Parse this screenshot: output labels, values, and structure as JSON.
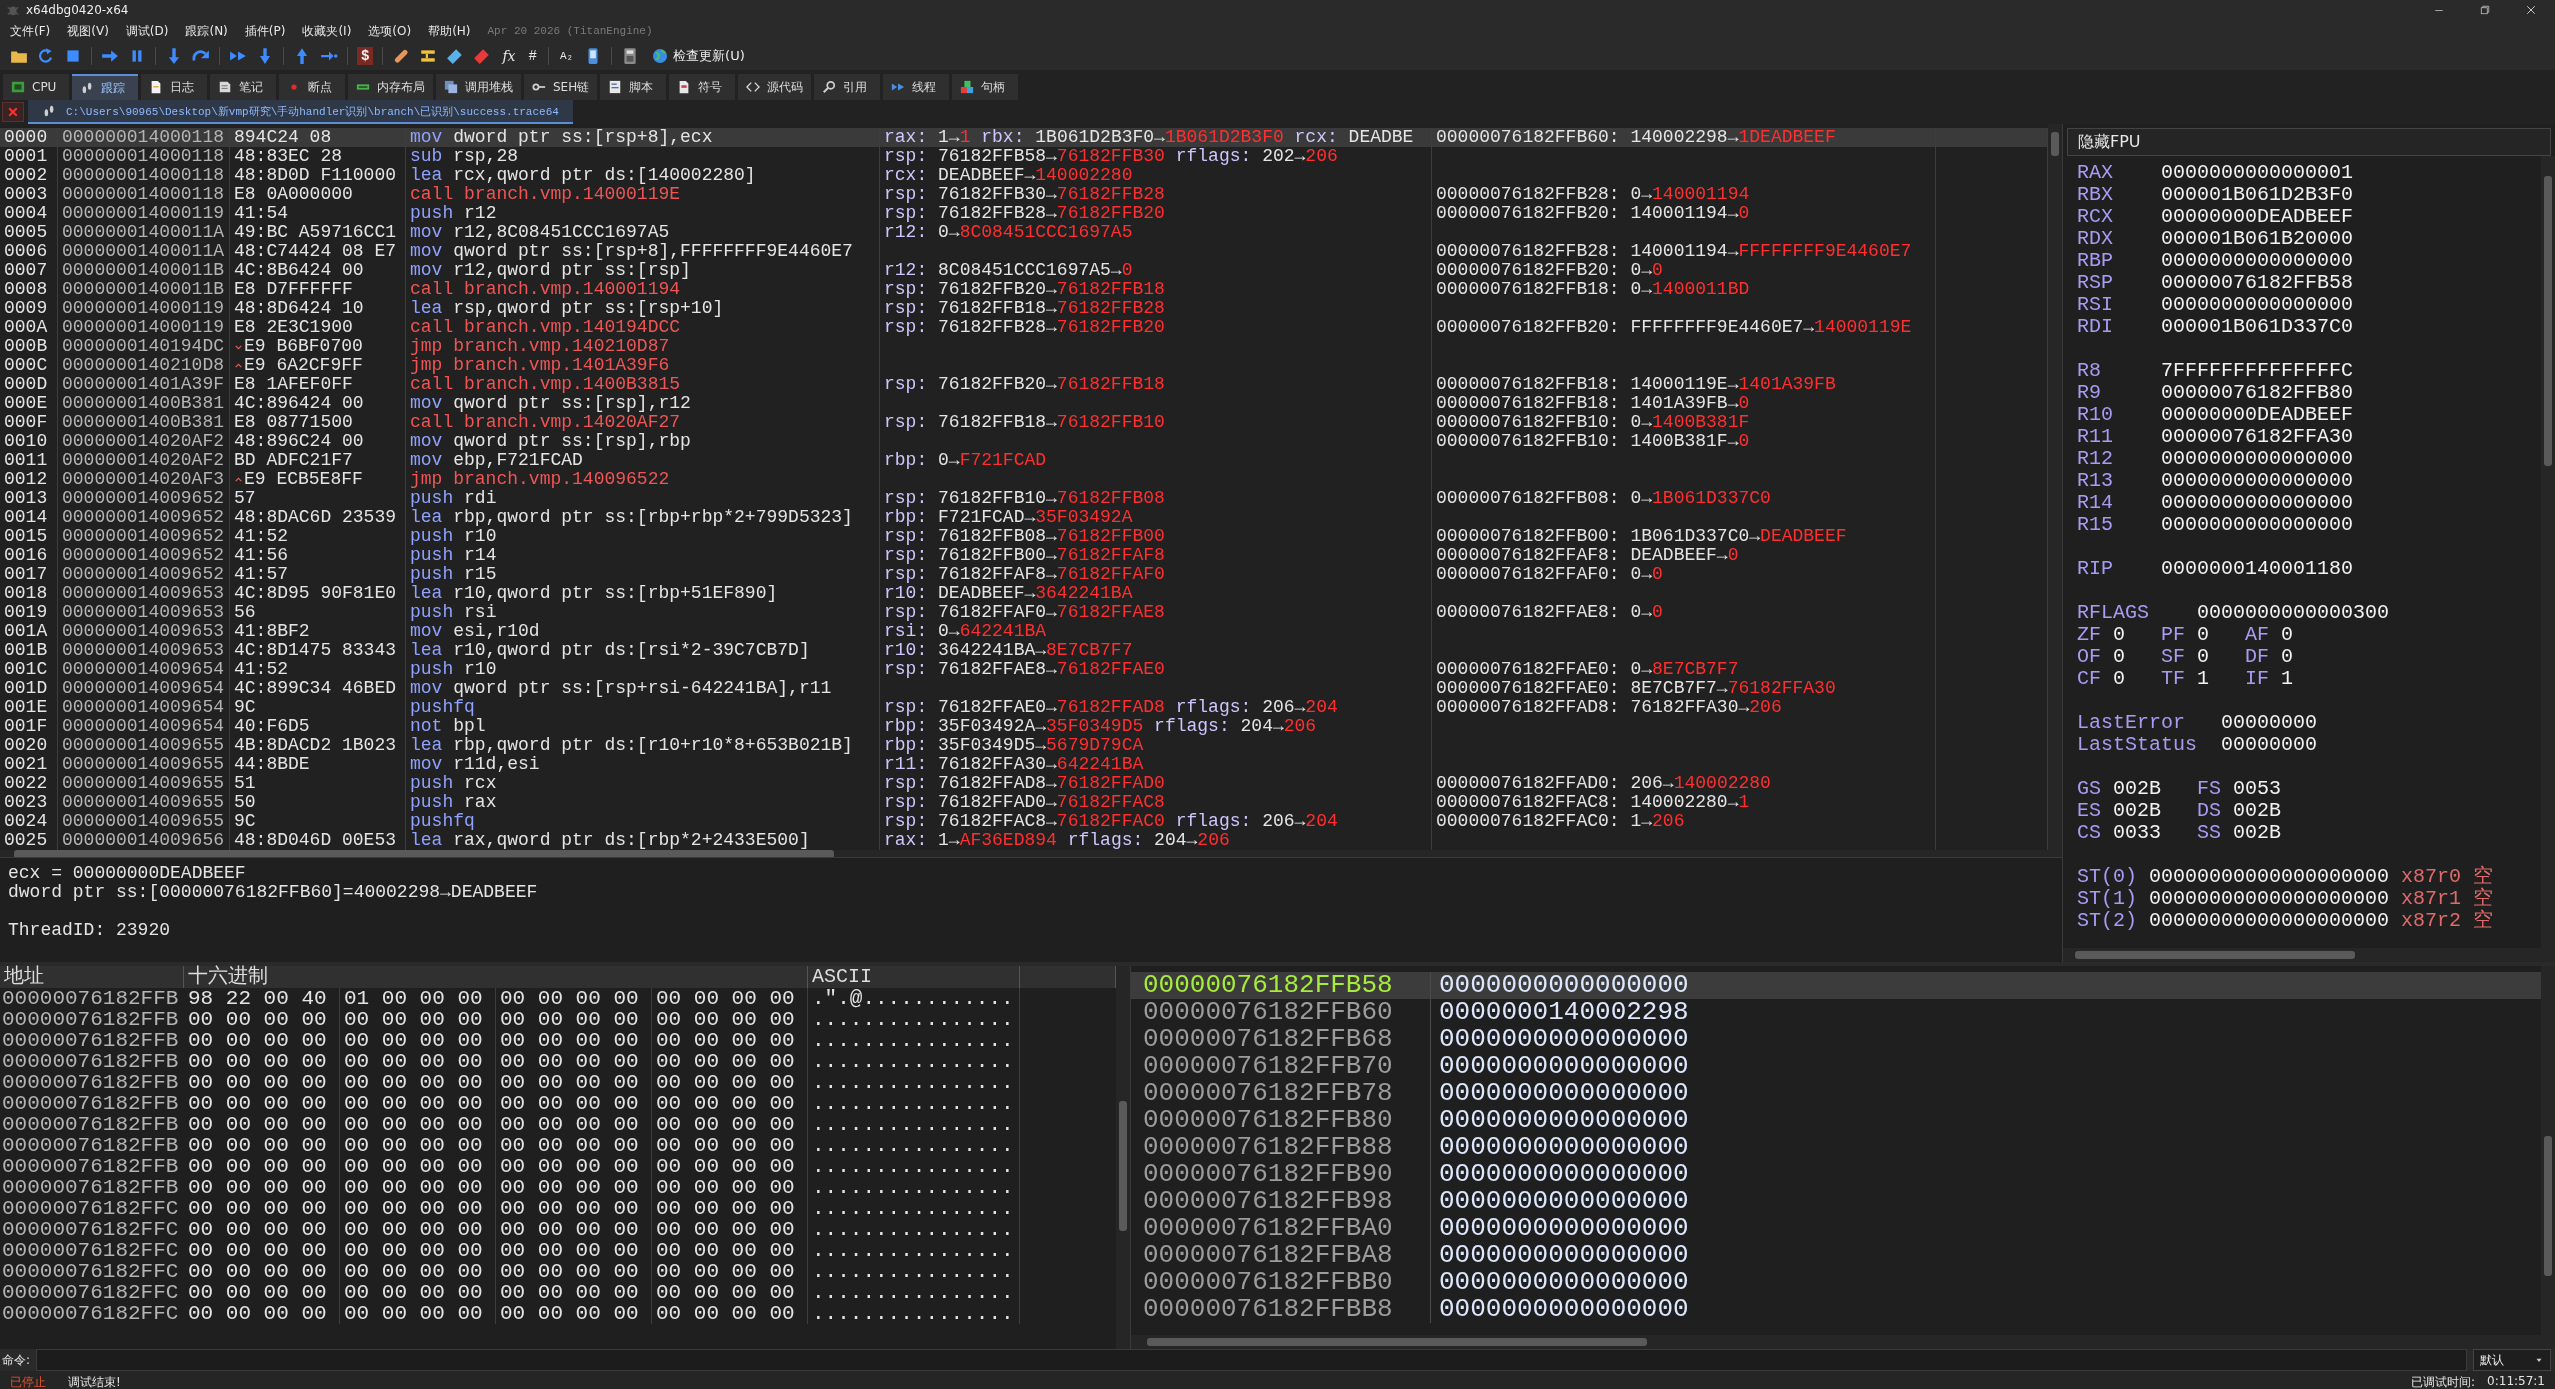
{
  "window": {
    "title": "x64dbg0420-x64"
  },
  "menu": [
    "文件(F)",
    "视图(V)",
    "调试(D)",
    "跟踪(N)",
    "插件(P)",
    "收藏夹(I)",
    "选项(O)",
    "帮助(H)"
  ],
  "build": "Apr 20 2026 (TitanEngine)",
  "toolbar": {
    "glyphs": [
      "$",
      "fx",
      "#",
      "A₂"
    ],
    "update": "检查更新(U)"
  },
  "tabs": [
    {
      "label": "CPU",
      "selected": false
    },
    {
      "label": "跟踪",
      "selected": true
    },
    {
      "label": "日志",
      "selected": false
    },
    {
      "label": "笔记",
      "selected": false
    },
    {
      "label": "断点",
      "selected": false
    },
    {
      "label": "内存布局",
      "selected": false
    },
    {
      "label": "调用堆栈",
      "selected": false
    },
    {
      "label": "SEH链",
      "selected": false
    },
    {
      "label": "脚本",
      "selected": false
    },
    {
      "label": "符号",
      "selected": false
    },
    {
      "label": "源代码",
      "selected": false
    },
    {
      "label": "引用",
      "selected": false
    },
    {
      "label": "线程",
      "selected": false
    },
    {
      "label": "句柄",
      "selected": false
    }
  ],
  "file_tab": {
    "path": "C:\\Users\\90965\\Desktop\\新vmp研究\\手动handler识别\\branch\\已识别\\success.trace64"
  },
  "trace": {
    "rows": [
      {
        "index": "0000",
        "address": "000000014000118",
        "bytes": "894C24 08",
        "mnemonic": "mov",
        "operands": "dword ptr ss:[rsp+8],ecx",
        "kind": "normal",
        "selected": true,
        "regs": [
          {
            "reg": "rax:",
            "old": "1→",
            "new": "1"
          },
          {
            "reg": "rbx:",
            "old": "1B061D2B3F0→",
            "new": "1B061D2B3F0"
          },
          {
            "reg": "rcx:",
            "old": "DEADBE"
          }
        ],
        "mem": {
          "address": "00000076182FFB60:",
          "old": "140002298→",
          "new": "1DEADBEEF"
        }
      },
      {
        "index": "0001",
        "address": "000000014000118",
        "bytes": "48:83EC 28",
        "mnemonic": "sub",
        "operands": "rsp,28",
        "kind": "normal",
        "selected": false,
        "regs": [
          {
            "reg": "rsp:",
            "old": "76182FFB58→",
            "new": "76182FFB30"
          },
          {
            "reg": "rflags:",
            "old": "202→",
            "new": "206"
          }
        ]
      },
      {
        "index": "0002",
        "address": "000000014000118",
        "bytes": "48:8D0D F110000",
        "mnemonic": "lea",
        "operands": "rcx,qword ptr ds:[140002280]",
        "kind": "normal",
        "selected": false,
        "regs": [
          {
            "reg": "rcx:",
            "old": "DEADBEEF→",
            "new": "140002280"
          }
        ]
      },
      {
        "index": "0003",
        "address": "000000014000118",
        "bytes": "E8 0A000000",
        "mnemonic": "call",
        "operands": "branch.vmp.14000119E",
        "kind": "branch",
        "selected": false,
        "regs": [
          {
            "reg": "rsp:",
            "old": "76182FFB30→",
            "new": "76182FFB28"
          }
        ],
        "mem": {
          "address": "00000076182FFB28:",
          "old": "0→",
          "new": "140001194"
        }
      },
      {
        "index": "0004",
        "address": "000000014000119",
        "bytes": "41:54",
        "mnemonic": "push",
        "operands": "r12",
        "kind": "normal",
        "selected": false,
        "regs": [
          {
            "reg": "rsp:",
            "old": "76182FFB28→",
            "new": "76182FFB20"
          }
        ],
        "mem": {
          "address": "00000076182FFB20:",
          "old": "140001194→",
          "new": "0"
        }
      },
      {
        "index": "0005",
        "address": "00000001400011A",
        "bytes": "49:BC A59716CC1",
        "mnemonic": "mov",
        "operands": "r12,8C08451CCC1697A5",
        "kind": "normal",
        "selected": false,
        "regs": [
          {
            "reg": "r12:",
            "old": "0→",
            "new": "8C08451CCC1697A5"
          }
        ]
      },
      {
        "index": "0006",
        "address": "00000001400011A",
        "bytes": "48:C74424 08 E7",
        "mnemonic": "mov",
        "operands": "qword ptr ss:[rsp+8],FFFFFFFF9E4460E7",
        "kind": "normal",
        "selected": false,
        "mem": {
          "address": "00000076182FFB28:",
          "old": "140001194→",
          "new": "FFFFFFFF9E4460E7"
        }
      },
      {
        "index": "0007",
        "address": "00000001400011B",
        "bytes": "4C:8B6424 00",
        "mnemonic": "mov",
        "operands": "r12,qword ptr ss:[rsp]",
        "kind": "normal",
        "selected": false,
        "regs": [
          {
            "reg": "r12:",
            "old": "8C08451CCC1697A5→",
            "new": "0"
          }
        ],
        "mem": {
          "address": "00000076182FFB20:",
          "old": "0→",
          "new": "0"
        }
      },
      {
        "index": "0008",
        "address": "00000001400011B",
        "bytes": "E8 D7FFFFFF",
        "mnemonic": "call",
        "operands": "branch.vmp.140001194",
        "kind": "branch",
        "selected": false,
        "regs": [
          {
            "reg": "rsp:",
            "old": "76182FFB20→",
            "new": "76182FFB18"
          }
        ],
        "mem": {
          "address": "00000076182FFB18:",
          "old": "0→",
          "new": "1400011BD"
        }
      },
      {
        "index": "0009",
        "address": "000000014000119",
        "bytes": "48:8D6424 10",
        "mnemonic": "lea",
        "operands": "rsp,qword ptr ss:[rsp+10]",
        "kind": "normal",
        "selected": false,
        "regs": [
          {
            "reg": "rsp:",
            "old": "76182FFB18→",
            "new": "76182FFB28"
          }
        ]
      },
      {
        "index": "000A",
        "address": "000000014000119",
        "bytes": "E8 2E3C1900",
        "mnemonic": "call",
        "operands": "branch.vmp.140194DCC",
        "kind": "branch",
        "selected": false,
        "regs": [
          {
            "reg": "rsp:",
            "old": "76182FFB28→",
            "new": "76182FFB20"
          }
        ],
        "mem": {
          "address": "00000076182FFB20:",
          "old": "FFFFFFFF9E4460E7→",
          "new": "14000119E"
        }
      },
      {
        "index": "000B",
        "address": "0000000140194DC",
        "bytes": "E9 B6BF0700",
        "jump_up": false,
        "mnemonic": "jmp",
        "operands": "branch.vmp.140210D87",
        "kind": "branch",
        "selected": false
      },
      {
        "index": "000C",
        "address": "0000000140210D8",
        "bytes": "E9 6A2CF9FF",
        "jump_up": true,
        "mnemonic": "jmp",
        "operands": "branch.vmp.1401A39F6",
        "kind": "branch",
        "selected": false
      },
      {
        "index": "000D",
        "address": "00000001401A39F",
        "bytes": "E8 1AFEF0FF",
        "mnemonic": "call",
        "operands": "branch.vmp.1400B3815",
        "kind": "branch",
        "selected": false,
        "regs": [
          {
            "reg": "rsp:",
            "old": "76182FFB20→",
            "new": "76182FFB18"
          }
        ],
        "mem": {
          "address": "00000076182FFB18:",
          "old": "14000119E→",
          "new": "1401A39FB"
        }
      },
      {
        "index": "000E",
        "address": "00000001400B381",
        "bytes": "4C:896424 00",
        "mnemonic": "mov",
        "operands": "qword ptr ss:[rsp],r12",
        "kind": "normal",
        "selected": false,
        "mem": {
          "address": "00000076182FFB18:",
          "old": "1401A39FB→",
          "new": "0"
        }
      },
      {
        "index": "000F",
        "address": "00000001400B381",
        "bytes": "E8 08771500",
        "mnemonic": "call",
        "operands": "branch.vmp.14020AF27",
        "kind": "branch",
        "selected": false,
        "regs": [
          {
            "reg": "rsp:",
            "old": "76182FFB18→",
            "new": "76182FFB10"
          }
        ],
        "mem": {
          "address": "00000076182FFB10:",
          "old": "0→",
          "new": "1400B381F"
        }
      },
      {
        "index": "0010",
        "address": "000000014020AF2",
        "bytes": "48:896C24 00",
        "mnemonic": "mov",
        "operands": "qword ptr ss:[rsp],rbp",
        "kind": "normal",
        "selected": false,
        "mem": {
          "address": "00000076182FFB10:",
          "old": "1400B381F→",
          "new": "0"
        }
      },
      {
        "index": "0011",
        "address": "000000014020AF2",
        "bytes": "BD ADFC21F7",
        "mnemonic": "mov",
        "operands": "ebp,F721FCAD",
        "kind": "normal",
        "selected": false,
        "regs": [
          {
            "reg": "rbp:",
            "old": "0→",
            "new": "F721FCAD"
          }
        ]
      },
      {
        "index": "0012",
        "address": "000000014020AF3",
        "bytes": "E9 ECB5E8FF",
        "jump_up": true,
        "mnemonic": "jmp",
        "operands": "branch.vmp.140096522",
        "kind": "branch",
        "selected": false
      },
      {
        "index": "0013",
        "address": "000000014009652",
        "bytes": "57",
        "mnemonic": "push",
        "operands": "rdi",
        "kind": "normal",
        "selected": false,
        "regs": [
          {
            "reg": "rsp:",
            "old": "76182FFB10→",
            "new": "76182FFB08"
          }
        ],
        "mem": {
          "address": "00000076182FFB08:",
          "old": "0→",
          "new": "1B061D337C0"
        }
      },
      {
        "index": "0014",
        "address": "000000014009652",
        "bytes": "48:8DAC6D 23539",
        "mnemonic": "lea",
        "operands": "rbp,qword ptr ss:[rbp+rbp*2+799D5323]",
        "kind": "normal",
        "selected": false,
        "regs": [
          {
            "reg": "rbp:",
            "old": "F721FCAD→",
            "new": "35F03492A"
          }
        ]
      },
      {
        "index": "0015",
        "address": "000000014009652",
        "bytes": "41:52",
        "mnemonic": "push",
        "operands": "r10",
        "kind": "normal",
        "selected": false,
        "regs": [
          {
            "reg": "rsp:",
            "old": "76182FFB08→",
            "new": "76182FFB00"
          }
        ],
        "mem": {
          "address": "00000076182FFB00:",
          "old": "1B061D337C0→",
          "new": "DEADBEEF"
        }
      },
      {
        "index": "0016",
        "address": "000000014009652",
        "bytes": "41:56",
        "mnemonic": "push",
        "operands": "r14",
        "kind": "normal",
        "selected": false,
        "regs": [
          {
            "reg": "rsp:",
            "old": "76182FFB00→",
            "new": "76182FFAF8"
          }
        ],
        "mem": {
          "address": "00000076182FFAF8:",
          "old": "DEADBEEF→",
          "new": "0"
        }
      },
      {
        "index": "0017",
        "address": "000000014009652",
        "bytes": "41:57",
        "mnemonic": "push",
        "operands": "r15",
        "kind": "normal",
        "selected": false,
        "regs": [
          {
            "reg": "rsp:",
            "old": "76182FFAF8→",
            "new": "76182FFAF0"
          }
        ],
        "mem": {
          "address": "00000076182FFAF0:",
          "old": "0→",
          "new": "0"
        }
      },
      {
        "index": "0018",
        "address": "000000014009653",
        "bytes": "4C:8D95 90F81E0",
        "mnemonic": "lea",
        "operands": "r10,qword ptr ss:[rbp+51EF890]",
        "kind": "normal",
        "selected": false,
        "regs": [
          {
            "reg": "r10:",
            "old": "DEADBEEF→",
            "new": "3642241BA"
          }
        ]
      },
      {
        "index": "0019",
        "address": "000000014009653",
        "bytes": "56",
        "mnemonic": "push",
        "operands": "rsi",
        "kind": "normal",
        "selected": false,
        "regs": [
          {
            "reg": "rsp:",
            "old": "76182FFAF0→",
            "new": "76182FFAE8"
          }
        ],
        "mem": {
          "address": "00000076182FFAE8:",
          "old": "0→",
          "new": "0"
        }
      },
      {
        "index": "001A",
        "address": "000000014009653",
        "bytes": "41:8BF2",
        "mnemonic": "mov",
        "operands": "esi,r10d",
        "kind": "normal",
        "selected": false,
        "regs": [
          {
            "reg": "rsi:",
            "old": "0→",
            "new": "642241BA"
          }
        ]
      },
      {
        "index": "001B",
        "address": "000000014009653",
        "bytes": "4C:8D1475 83343",
        "mnemonic": "lea",
        "operands": "r10,qword ptr ds:[rsi*2-39C7CB7D]",
        "kind": "normal",
        "selected": false,
        "regs": [
          {
            "reg": "r10:",
            "old": "3642241BA→",
            "new": "8E7CB7F7"
          }
        ]
      },
      {
        "index": "001C",
        "address": "000000014009654",
        "bytes": "41:52",
        "mnemonic": "push",
        "operands": "r10",
        "kind": "normal",
        "selected": false,
        "regs": [
          {
            "reg": "rsp:",
            "old": "76182FFAE8→",
            "new": "76182FFAE0"
          }
        ],
        "mem": {
          "address": "00000076182FFAE0:",
          "old": "0→",
          "new": "8E7CB7F7"
        }
      },
      {
        "index": "001D",
        "address": "000000014009654",
        "bytes": "4C:899C34 46BED",
        "mnemonic": "mov",
        "operands": "qword ptr ss:[rsp+rsi-642241BA],r11",
        "kind": "normal",
        "selected": false,
        "mem": {
          "address": "00000076182FFAE0:",
          "old": "8E7CB7F7→",
          "new": "76182FFA30"
        }
      },
      {
        "index": "001E",
        "address": "000000014009654",
        "bytes": "9C",
        "mnemonic": "pushfq",
        "kind": "normal",
        "selected": false,
        "regs": [
          {
            "reg": "rsp:",
            "old": "76182FFAE0→",
            "new": "76182FFAD8"
          },
          {
            "reg": "rflags:",
            "old": "206→",
            "new": "204"
          }
        ],
        "mem": {
          "address": "00000076182FFAD8:",
          "old": "76182FFA30→",
          "new": "206"
        }
      },
      {
        "index": "001F",
        "address": "000000014009654",
        "bytes": "40:F6D5",
        "mnemonic": "not",
        "operands": "bpl",
        "kind": "normal",
        "selected": false,
        "regs": [
          {
            "reg": "rbp:",
            "old": "35F03492A→",
            "new": "35F0349D5"
          },
          {
            "reg": "rflags:",
            "old": "204→",
            "new": "206"
          }
        ]
      },
      {
        "index": "0020",
        "address": "000000014009655",
        "bytes": "4B:8DACD2 1B023",
        "mnemonic": "lea",
        "operands": "rbp,qword ptr ds:[r10+r10*8+653B021B]",
        "kind": "normal",
        "selected": false,
        "regs": [
          {
            "reg": "rbp:",
            "old": "35F0349D5→",
            "new": "5679D79CA"
          }
        ]
      },
      {
        "index": "0021",
        "address": "000000014009655",
        "bytes": "44:8BDE",
        "mnemonic": "mov",
        "operands": "r11d,esi",
        "kind": "normal",
        "selected": false,
        "regs": [
          {
            "reg": "r11:",
            "old": "76182FFA30→",
            "new": "642241BA"
          }
        ]
      },
      {
        "index": "0022",
        "address": "000000014009655",
        "bytes": "51",
        "mnemonic": "push",
        "operands": "rcx",
        "kind": "normal",
        "selected": false,
        "regs": [
          {
            "reg": "rsp:",
            "old": "76182FFAD8→",
            "new": "76182FFAD0"
          }
        ],
        "mem": {
          "address": "00000076182FFAD0:",
          "old": "206→",
          "new": "140002280"
        }
      },
      {
        "index": "0023",
        "address": "000000014009655",
        "bytes": "50",
        "mnemonic": "push",
        "operands": "rax",
        "kind": "normal",
        "selected": false,
        "regs": [
          {
            "reg": "rsp:",
            "old": "76182FFAD0→",
            "new": "76182FFAC8"
          }
        ],
        "mem": {
          "address": "00000076182FFAC8:",
          "old": "140002280→",
          "new": "1"
        }
      },
      {
        "index": "0024",
        "address": "000000014009655",
        "bytes": "9C",
        "mnemonic": "pushfq",
        "kind": "normal",
        "selected": false,
        "regs": [
          {
            "reg": "rsp:",
            "old": "76182FFAC8→",
            "new": "76182FFAC0"
          },
          {
            "reg": "rflags:",
            "old": "206→",
            "new": "204"
          }
        ],
        "mem": {
          "address": "00000076182FFAC0:",
          "old": "1→",
          "new": "206"
        }
      },
      {
        "index": "0025",
        "address": "000000014009656",
        "bytes": "48:8D046D 00E53",
        "mnemonic": "lea",
        "operands": "rax,qword ptr ds:[rbp*2+2433E500]",
        "kind": "normal",
        "selected": false,
        "regs": [
          {
            "reg": "rax:",
            "old": "1→",
            "new": "AF36ED894"
          },
          {
            "reg": "rflags:",
            "old": "204→",
            "new": "206"
          }
        ]
      }
    ]
  },
  "info": {
    "lines": [
      "ecx = 00000000DEADBEEF",
      "dword ptr ss:[00000076182FFB60]=40002298→DEADBEEF"
    ],
    "thread": "ThreadID: 23920"
  },
  "registers": {
    "toggle": "隐藏FPU",
    "groups": [
      {
        "kind": "list",
        "rows": [
          {
            "name": "RAX",
            "value": "0000000000000001"
          },
          {
            "name": "RBX",
            "value": "000001B061D2B3F0"
          },
          {
            "name": "RCX",
            "value": "00000000DEADBEEF"
          },
          {
            "name": "RDX",
            "value": "000001B061B20000"
          },
          {
            "name": "RBP",
            "value": "0000000000000000"
          },
          {
            "name": "RSP",
            "value": "00000076182FFB58"
          },
          {
            "name": "RSI",
            "value": "0000000000000000"
          },
          {
            "name": "RDI",
            "value": "000001B061D337C0"
          }
        ]
      },
      {
        "kind": "list",
        "rows": [
          {
            "name": "R8",
            "value": "7FFFFFFFFFFFFFFC"
          },
          {
            "name": "R9",
            "value": "00000076182FFB80"
          },
          {
            "name": "R10",
            "value": "00000000DEADBEEF"
          },
          {
            "name": "R11",
            "value": "00000076182FFA30"
          },
          {
            "name": "R12",
            "value": "0000000000000000"
          },
          {
            "name": "R13",
            "value": "0000000000000000"
          },
          {
            "name": "R14",
            "value": "0000000000000000"
          },
          {
            "name": "R15",
            "value": "0000000000000000"
          }
        ]
      },
      {
        "kind": "list",
        "rows": [
          {
            "name": "RIP",
            "value": "0000000140001180"
          }
        ]
      },
      {
        "kind": "flags",
        "header": {
          "name": "RFLAGS",
          "value": "0000000000000300"
        },
        "rows": [
          [
            {
              "name": "ZF",
              "value": "0"
            },
            {
              "name": "PF",
              "value": "0"
            },
            {
              "name": "AF",
              "value": "0"
            }
          ],
          [
            {
              "name": "OF",
              "value": "0"
            },
            {
              "name": "SF",
              "value": "0"
            },
            {
              "name": "DF",
              "value": "0"
            }
          ],
          [
            {
              "name": "CF",
              "value": "0"
            },
            {
              "name": "TF",
              "value": "1"
            },
            {
              "name": "IF",
              "value": "1"
            }
          ]
        ]
      },
      {
        "kind": "list",
        "rows": [
          {
            "name": "LastError",
            "value": "00000000"
          },
          {
            "name": "LastStatus",
            "value": "00000000"
          }
        ]
      },
      {
        "kind": "grid",
        "rows": [
          [
            {
              "name": "GS",
              "value": "002B"
            },
            {
              "name": "FS",
              "value": "0053"
            }
          ],
          [
            {
              "name": "ES",
              "value": "002B"
            },
            {
              "name": "DS",
              "value": "002B"
            }
          ],
          [
            {
              "name": "CS",
              "value": "0033"
            },
            {
              "name": "SS",
              "value": "002B"
            }
          ]
        ]
      },
      {
        "kind": "fpu",
        "rows": [
          {
            "name": "ST(0)",
            "value": "00000000000000000000",
            "tag": "x87r0",
            "status": "空"
          },
          {
            "name": "ST(1)",
            "value": "00000000000000000000",
            "tag": "x87r1",
            "status": "空"
          },
          {
            "name": "ST(2)",
            "value": "00000000000000000000",
            "tag": "x87r2",
            "status": "空"
          }
        ]
      }
    ]
  },
  "hex": {
    "columns": [
      "地址",
      "十六进制",
      "ASCII"
    ],
    "rows": [
      {
        "address": "00000076182FFB",
        "bytes": "98 22 00 40 01 00 00 00 00 00 00 00 00 00 00 00",
        "ascii": ".\".@............"
      },
      {
        "address": "00000076182FFB",
        "bytes": "00 00 00 00 00 00 00 00 00 00 00 00 00 00 00 00",
        "ascii": "................"
      },
      {
        "address": "00000076182FFB",
        "bytes": "00 00 00 00 00 00 00 00 00 00 00 00 00 00 00 00",
        "ascii": "................"
      },
      {
        "address": "00000076182FFB",
        "bytes": "00 00 00 00 00 00 00 00 00 00 00 00 00 00 00 00",
        "ascii": "................"
      },
      {
        "address": "00000076182FFB",
        "bytes": "00 00 00 00 00 00 00 00 00 00 00 00 00 00 00 00",
        "ascii": "................"
      },
      {
        "address": "00000076182FFB",
        "bytes": "00 00 00 00 00 00 00 00 00 00 00 00 00 00 00 00",
        "ascii": "................"
      },
      {
        "address": "00000076182FFB",
        "bytes": "00 00 00 00 00 00 00 00 00 00 00 00 00 00 00 00",
        "ascii": "................"
      },
      {
        "address": "00000076182FFB",
        "bytes": "00 00 00 00 00 00 00 00 00 00 00 00 00 00 00 00",
        "ascii": "................"
      },
      {
        "address": "00000076182FFB",
        "bytes": "00 00 00 00 00 00 00 00 00 00 00 00 00 00 00 00",
        "ascii": "................"
      },
      {
        "address": "00000076182FFB",
        "bytes": "00 00 00 00 00 00 00 00 00 00 00 00 00 00 00 00",
        "ascii": "................"
      },
      {
        "address": "00000076182FFC",
        "bytes": "00 00 00 00 00 00 00 00 00 00 00 00 00 00 00 00",
        "ascii": "................"
      },
      {
        "address": "00000076182FFC",
        "bytes": "00 00 00 00 00 00 00 00 00 00 00 00 00 00 00 00",
        "ascii": "................"
      },
      {
        "address": "00000076182FFC",
        "bytes": "00 00 00 00 00 00 00 00 00 00 00 00 00 00 00 00",
        "ascii": "................"
      },
      {
        "address": "00000076182FFC",
        "bytes": "00 00 00 00 00 00 00 00 00 00 00 00 00 00 00 00",
        "ascii": "................"
      },
      {
        "address": "00000076182FFC",
        "bytes": "00 00 00 00 00 00 00 00 00 00 00 00 00 00 00 00",
        "ascii": "................"
      },
      {
        "address": "00000076182FFC",
        "bytes": "00 00 00 00 00 00 00 00 00 00 00 00 00 00 00 00",
        "ascii": "................"
      }
    ]
  },
  "stack": {
    "rows": [
      {
        "address": "00000076182FFB58",
        "value": "0000000000000000",
        "selected": true
      },
      {
        "address": "00000076182FFB60",
        "value": "0000000140002298",
        "selected": false
      },
      {
        "address": "00000076182FFB68",
        "value": "0000000000000000",
        "selected": false
      },
      {
        "address": "00000076182FFB70",
        "value": "0000000000000000",
        "selected": false
      },
      {
        "address": "00000076182FFB78",
        "value": "0000000000000000",
        "selected": false
      },
      {
        "address": "00000076182FFB80",
        "value": "0000000000000000",
        "selected": false
      },
      {
        "address": "00000076182FFB88",
        "value": "0000000000000000",
        "selected": false
      },
      {
        "address": "00000076182FFB90",
        "value": "0000000000000000",
        "selected": false
      },
      {
        "address": "00000076182FFB98",
        "value": "0000000000000000",
        "selected": false
      },
      {
        "address": "00000076182FFBA0",
        "value": "0000000000000000",
        "selected": false
      },
      {
        "address": "00000076182FFBA8",
        "value": "0000000000000000",
        "selected": false
      },
      {
        "address": "00000076182FFBB0",
        "value": "0000000000000000",
        "selected": false
      },
      {
        "address": "00000076182FFBB8",
        "value": "0000000000000000",
        "selected": false
      }
    ]
  },
  "command": {
    "label": "命令:",
    "mode": "默认"
  },
  "status": {
    "state": "已停止",
    "message": "调试结束!",
    "time_label": "已调试时间:",
    "time": "0:11:57:1"
  }
}
